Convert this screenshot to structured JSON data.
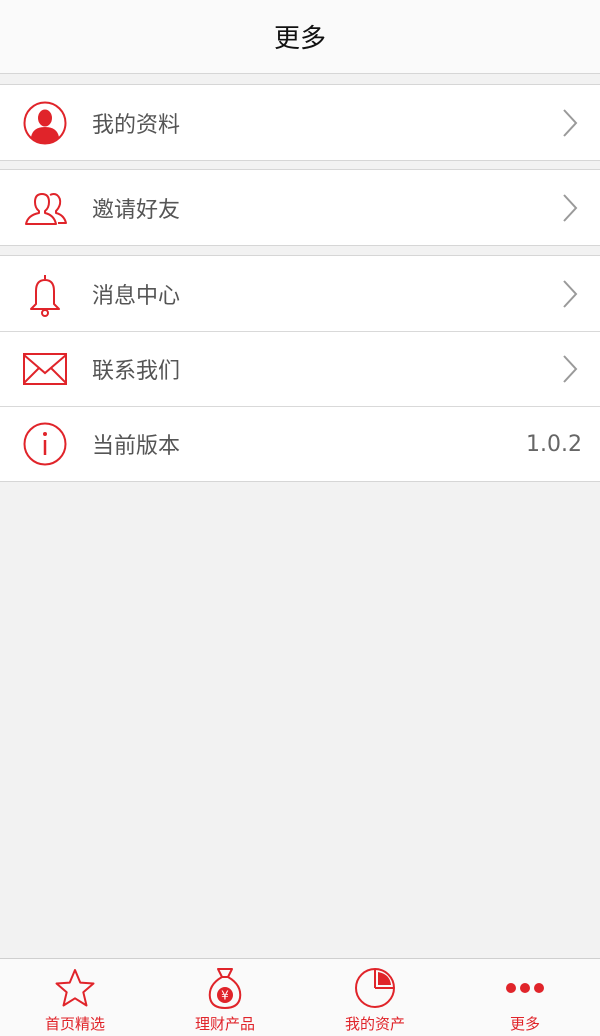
{
  "header": {
    "title": "更多"
  },
  "menu": {
    "profile": {
      "label": "我的资料",
      "icon": "user-avatar-icon"
    },
    "invite": {
      "label": "邀请好友",
      "icon": "friends-icon"
    },
    "messages": {
      "label": "消息中心",
      "icon": "bell-icon"
    },
    "contact": {
      "label": "联系我们",
      "icon": "envelope-icon"
    },
    "version": {
      "label": "当前版本",
      "value": "1.0.2",
      "icon": "info-icon"
    }
  },
  "tabs": [
    {
      "label": "首页精选",
      "icon": "star-icon"
    },
    {
      "label": "理财产品",
      "icon": "money-bag-icon"
    },
    {
      "label": "我的资产",
      "icon": "pie-chart-icon"
    },
    {
      "label": "更多",
      "icon": "more-dots-icon",
      "active": true
    }
  ],
  "colors": {
    "accent": "#e0242a",
    "background": "#f2f2f2"
  }
}
